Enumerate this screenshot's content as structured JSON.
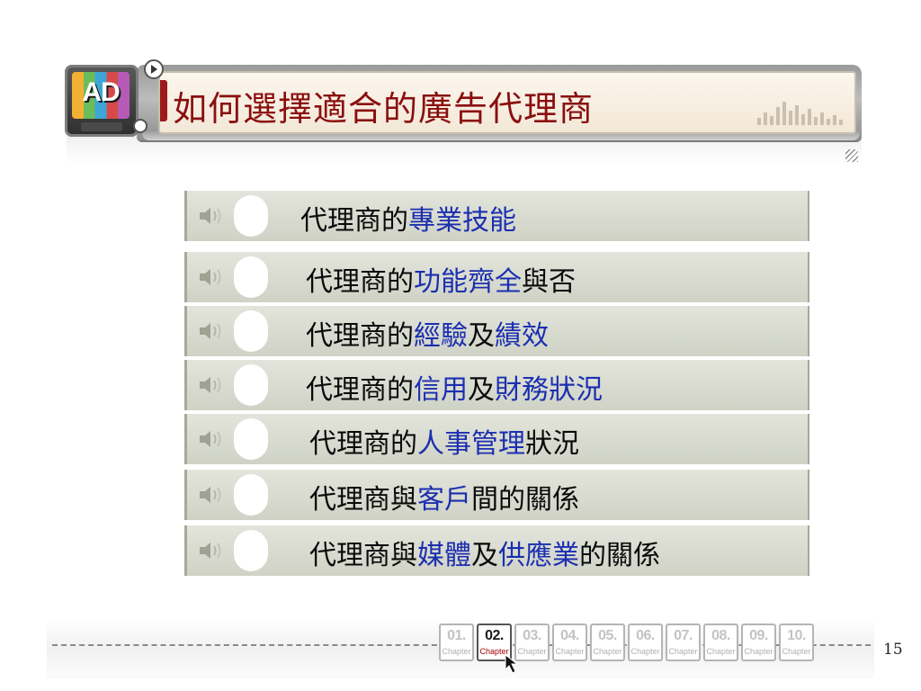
{
  "header": {
    "logo_text": "AD",
    "title": "如何選擇適合的廣告代理商"
  },
  "items": [
    {
      "prefix": "代理商的",
      "parts": [
        {
          "t": "專業技能",
          "hl": true
        }
      ]
    },
    {
      "prefix": "代理商的",
      "parts": [
        {
          "t": "功能齊全",
          "hl": true
        },
        {
          "t": "與否",
          "hl": false
        }
      ]
    },
    {
      "prefix": "代理商的",
      "parts": [
        {
          "t": "經驗",
          "hl": true
        },
        {
          "t": "及",
          "hl": false
        },
        {
          "t": "績效",
          "hl": true
        }
      ]
    },
    {
      "prefix": "代理商的",
      "parts": [
        {
          "t": "信用",
          "hl": true
        },
        {
          "t": "及",
          "hl": false
        },
        {
          "t": "財務狀況",
          "hl": true
        }
      ]
    },
    {
      "prefix": "代理商的",
      "parts": [
        {
          "t": "人事管理",
          "hl": true
        },
        {
          "t": "狀況",
          "hl": false
        }
      ]
    },
    {
      "prefix": "代理商與",
      "parts": [
        {
          "t": "客戶",
          "hl": true
        },
        {
          "t": "間的關係",
          "hl": false
        }
      ]
    },
    {
      "prefix": "代理商與",
      "parts": [
        {
          "t": "媒體",
          "hl": true
        },
        {
          "t": "及",
          "hl": false
        },
        {
          "t": "供應業",
          "hl": true
        },
        {
          "t": "的關係",
          "hl": false
        }
      ]
    }
  ],
  "footer": {
    "chapter_word": "Chapter",
    "chapters": [
      "01.",
      "02.",
      "03.",
      "04.",
      "05.",
      "06.",
      "07.",
      "08.",
      "09.",
      "10."
    ],
    "active_chapter": "02.",
    "page_number": "15"
  },
  "colors": {
    "title": "#8a0f0f",
    "highlight": "#1b2fb0",
    "row_background": "#d8dbce",
    "active_chapter_word": "#a40000"
  },
  "icons": {
    "item": "speaker-icon",
    "header": "ad-monitor-icon",
    "footer": "cursor-arrow-icon"
  }
}
